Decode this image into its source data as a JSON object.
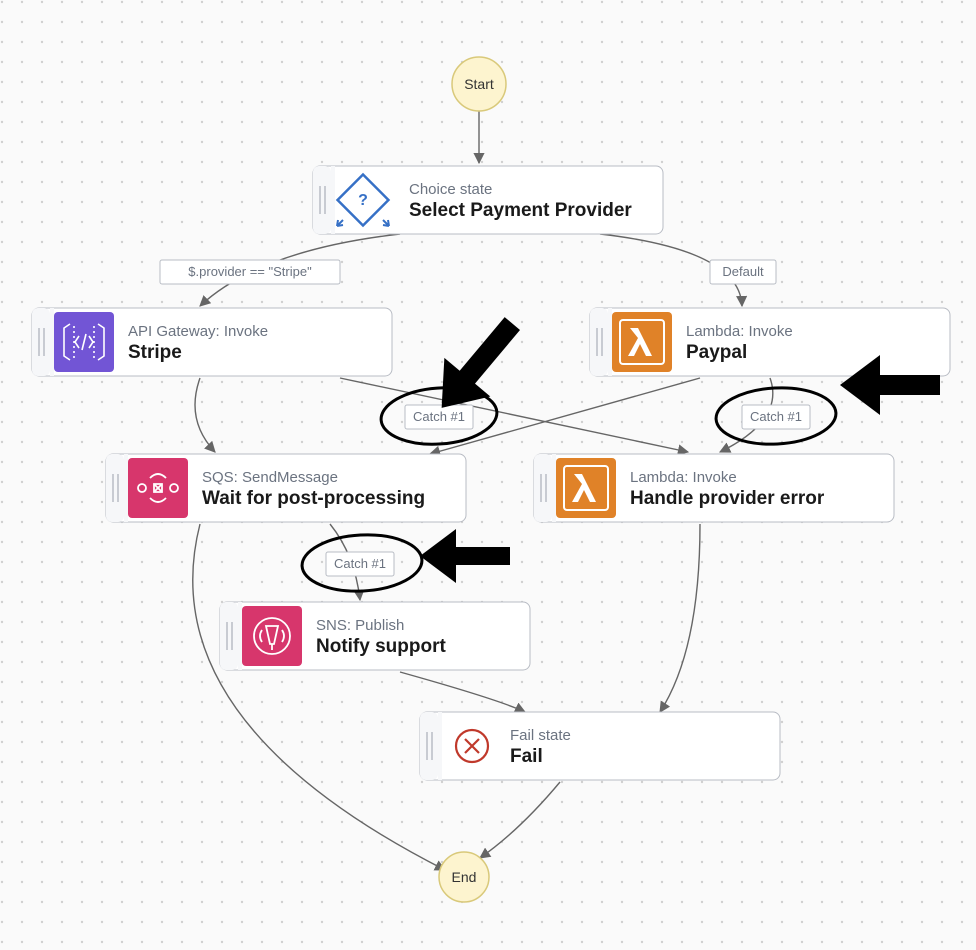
{
  "start": {
    "label": "Start"
  },
  "end": {
    "label": "End"
  },
  "choice": {
    "subtitle": "Choice state",
    "title": "Select Payment Provider"
  },
  "stripe": {
    "subtitle": "API Gateway: Invoke",
    "title": "Stripe"
  },
  "paypal": {
    "subtitle": "Lambda: Invoke",
    "title": "Paypal"
  },
  "sqs": {
    "subtitle": "SQS: SendMessage",
    "title": "Wait for post-processing"
  },
  "handler": {
    "subtitle": "Lambda: Invoke",
    "title": "Handle provider error"
  },
  "sns": {
    "subtitle": "SNS: Publish",
    "title": "Notify support"
  },
  "fail": {
    "subtitle": "Fail state",
    "title": "Fail"
  },
  "edgeLabels": {
    "stripeCond": "$.provider == \"Stripe\"",
    "default": "Default",
    "catch": "Catch #1"
  },
  "colors": {
    "start": "#fdf4cf",
    "startRim": "#d9c97a",
    "choiceIcon": "#3670c6",
    "apigw": "#7255d5",
    "lambda": "#e08228",
    "sqs": "#d7366c",
    "sns": "#d7366c",
    "failIcon": "#c0392b"
  }
}
